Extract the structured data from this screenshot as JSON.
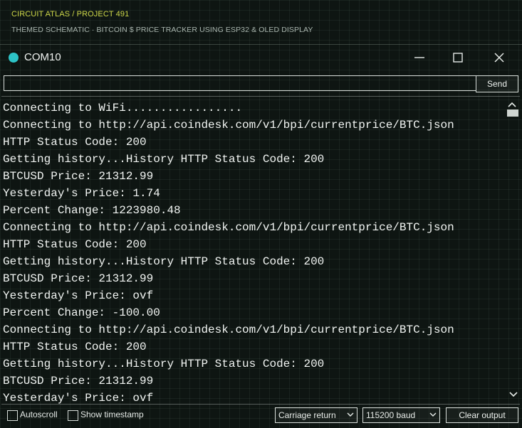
{
  "banner": {
    "kicker": "CIRCUIT ATLAS / PROJECT 491",
    "subtitle": "THEMED SCHEMATIC · BITCOIN $ PRICE TRACKER USING ESP32 & OLED DISPLAY"
  },
  "window": {
    "title": "COM10",
    "icons": {
      "app": "serial-monitor-icon",
      "minimize": "minimize-icon",
      "maximize": "maximize-icon",
      "close": "close-icon"
    }
  },
  "send": {
    "input_value": "",
    "input_placeholder": "",
    "button_label": "Send"
  },
  "console": {
    "lines": [
      "Connecting to WiFi.................",
      "Connecting to http://api.coindesk.com/v1/bpi/currentprice/BTC.json",
      "HTTP Status Code: 200",
      "Getting history...History HTTP Status Code: 200",
      "BTCUSD Price: 21312.99",
      "Yesterday's Price: 1.74",
      "Percent Change: 1223980.48",
      "Connecting to http://api.coindesk.com/v1/bpi/currentprice/BTC.json",
      "HTTP Status Code: 200",
      "Getting history...History HTTP Status Code: 200",
      "BTCUSD Price: 21312.99",
      "Yesterday's Price: ovf",
      "Percent Change: -100.00",
      "Connecting to http://api.coindesk.com/v1/bpi/currentprice/BTC.json",
      "HTTP Status Code: 200",
      "Getting history...History HTTP Status Code: 200",
      "BTCUSD Price: 21312.99",
      "Yesterday's Price: ovf"
    ]
  },
  "footer": {
    "autoscroll_label": "Autoscroll",
    "autoscroll_checked": false,
    "timestamp_label": "Show timestamp",
    "timestamp_checked": false,
    "line_ending": "Carriage return",
    "baud": "115200 baud",
    "clear_label": "Clear output"
  },
  "colors": {
    "accent": "#cfd94a",
    "app_icon": "#2dc3c6",
    "background": "#0e1512",
    "text": "#f2f5f3"
  }
}
